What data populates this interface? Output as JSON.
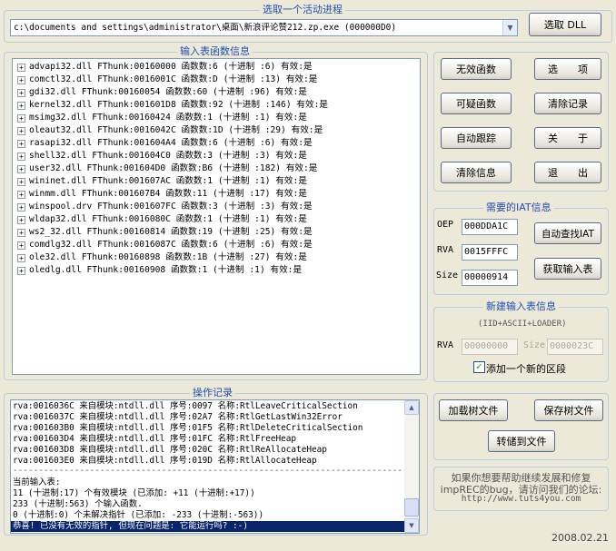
{
  "process_group": {
    "title": "选取一个活动进程",
    "selected_process": "c:\\documents and settings\\administrator\\桌面\\新浪评论赞212.zp.exe (000000D0)",
    "select_dll_label": "选取 DLL"
  },
  "import_group": {
    "title": "输入表函数信息",
    "items": [
      "advapi32.dll FThunk:00160000 函数数:6 (十进制 :6) 有效:是",
      "comctl32.dll FThunk:0016001C 函数数:D (十进制 :13) 有效:是",
      "gdi32.dll FThunk:00160054 函数数:60 (十进制 :96) 有效:是",
      "kernel32.dll FThunk:001601D8 函数数:92 (十进制 :146) 有效:是",
      "msimg32.dll FThunk:00160424 函数数:1 (十进制 :1) 有效:是",
      "oleaut32.dll FThunk:0016042C 函数数:1D (十进制 :29) 有效:是",
      "rasapi32.dll FThunk:001604A4 函数数:6 (十进制 :6) 有效:是",
      "shell32.dll FThunk:001604C0 函数数:3 (十进制 :3) 有效:是",
      "user32.dll FThunk:001604D0 函数数:B6 (十进制 :182) 有效:是",
      "wininet.dll FThunk:001607AC 函数数:1 (十进制 :1) 有效:是",
      "winmm.dll FThunk:001607B4 函数数:11 (十进制 :17) 有效:是",
      "winspool.drv FThunk:001607FC 函数数:3 (十进制 :3) 有效:是",
      "wldap32.dll FThunk:0016080C 函数数:1 (十进制 :1) 有效:是",
      "ws2_32.dll FThunk:00160814 函数数:19 (十进制 :25) 有效:是",
      "comdlg32.dll FThunk:0016087C 函数数:6 (十进制 :6) 有效:是",
      "ole32.dll FThunk:00160898 函数数:1B (十进制 :27) 有效:是",
      "oledlg.dll FThunk:00160908 函数数:1 (十进制 :1) 有效:是"
    ]
  },
  "buttons": {
    "invalid_funcs": "无效函数",
    "suspect_funcs": "可疑函数",
    "auto_trace": "自动跟踪",
    "clear_info": "清除信息",
    "options": "选　　项",
    "clear_log": "清除记录",
    "about": "关　　于",
    "exit": "退　　出"
  },
  "iat_group": {
    "title": "需要的IAT信息",
    "oep_label": "OEP",
    "oep_value": "000DDA1C",
    "rva_label": "RVA",
    "rva_value": "0015FFFC",
    "size_label": "Size",
    "size_value": "00000914",
    "auto_find_label": "自动查找IAT",
    "get_imports_label": "获取输入表"
  },
  "new_import_group": {
    "title": "新建输入表信息",
    "subtitle": "(IID+ASCII+LOADER)",
    "rva_label": "RVA",
    "rva_value": "00000000",
    "size_label": "Size",
    "size_value": "0000023C",
    "add_section_label": "添加一个新的区段",
    "add_section_checked": true
  },
  "log_group": {
    "title": "操作记录",
    "lines": [
      "rva:0016036C 来自模块:ntdll.dll 序号:0097 名称:RtlLeaveCriticalSection",
      "rva:0016037C 来自模块:ntdll.dll 序号:02A7 名称:RtlGetLastWin32Error",
      "rva:001603B0 来自模块:ntdll.dll 序号:01F5 名称:RtlDeleteCriticalSection",
      "rva:001603D4 来自模块:ntdll.dll 序号:01FC 名称:RtlFreeHeap",
      "rva:001603D8 来自模块:ntdll.dll 序号:020C 名称:RtlReAllocateHeap",
      "rva:001603E0 来自模块:ntdll.dll 序号:019D 名称:RtlAllocateHeap"
    ],
    "separator": "------------------------------------------------------------------------------",
    "summary_title": "当前输入表:",
    "summary_lines": [
      "11 (十进制:17) 个有效模块 (已添加: +11 (十进制:+17))",
      "233 (十进制:563) 个输入函数.",
      "0 (十进制:0) 个未解决指针 (已添加: -233 (十进制:-563))"
    ],
    "highlight": "恭喜! 已没有无效的指针, 但现在问题是: 它能运行吗? :-)"
  },
  "tree_buttons": {
    "load_tree": "加载树文件",
    "save_tree": "保存树文件",
    "save_to_file": "转储到文件"
  },
  "info": {
    "text1": "如果你想要帮助继续发展和修复",
    "text2": "impREC的bug，请访问我们的论坛:",
    "url": "http://www.tuts4you.com",
    "date": "2008.02.21"
  },
  "colors": {
    "window_bg": "#ece9d8",
    "group_title": "#1f4fb6",
    "selection_bg": "#0a246a"
  }
}
